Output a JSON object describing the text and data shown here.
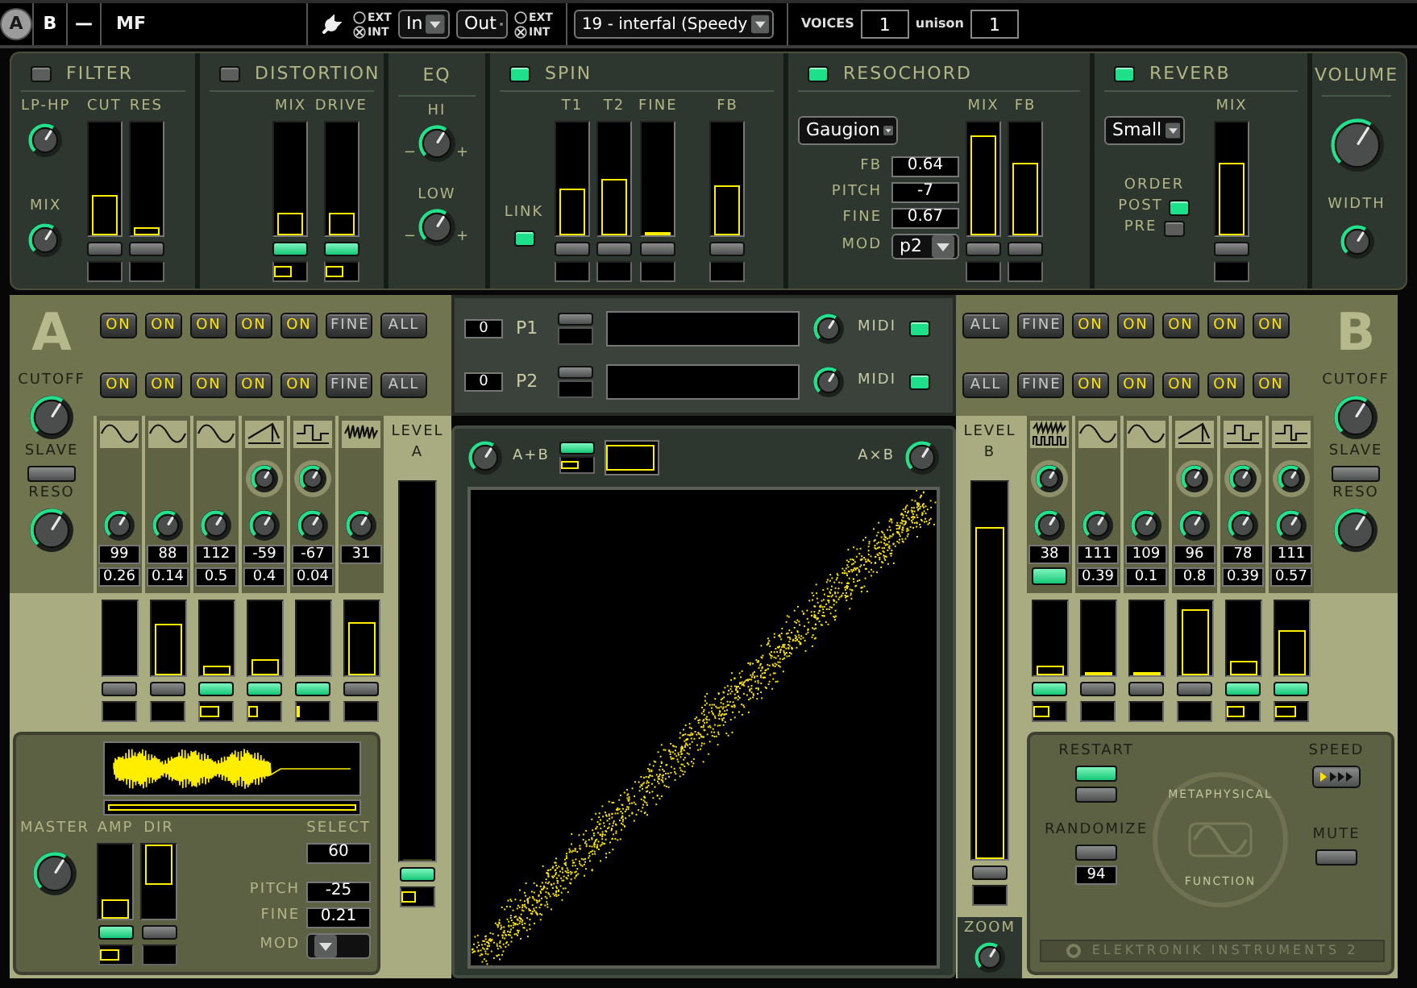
{
  "top_bar": {
    "tabs": [
      {
        "label": "A",
        "selected": true
      },
      {
        "label": "B",
        "selected": false
      },
      {
        "label": "—",
        "selected": false
      }
    ],
    "preset": "MF",
    "in_sync": [
      {
        "label": "EXT",
        "selected": false
      },
      {
        "label": "INT",
        "selected": true
      }
    ],
    "input": "In",
    "output": "Out",
    "out_sync": [
      {
        "label": "EXT",
        "selected": false
      },
      {
        "label": "INT",
        "selected": true
      }
    ],
    "program": "19 - interfal (Speedy",
    "voices_label": "VOICES",
    "voices": "1",
    "unison_label": "unison",
    "unison": "1"
  },
  "effects": [
    {
      "kind": "filter",
      "title": "FILTER",
      "on": false,
      "knobs": [
        {
          "label": "LP-HP"
        },
        {
          "label": "MIX"
        }
      ],
      "faders": [
        {
          "label": "CUT",
          "level": 0.36,
          "on": false
        },
        {
          "label": "RES",
          "level": 0.07,
          "on": false
        }
      ]
    },
    {
      "kind": "distortion",
      "title": "DISTORTION",
      "on": false,
      "faders": [
        {
          "label": "MIX",
          "level": 0.2,
          "on": true,
          "mod": {
            "level": 0.55
          }
        },
        {
          "label": "DRIVE",
          "level": 0.2,
          "on": true,
          "mod": {
            "level": 0.55
          }
        }
      ]
    },
    {
      "kind": "eq",
      "title": "EQ",
      "knobs": [
        {
          "label": "HI",
          "min_label": "−",
          "max_label": "+"
        },
        {
          "label": "LOW",
          "min_label": "−",
          "max_label": "+"
        }
      ]
    },
    {
      "kind": "spin",
      "title": "SPIN",
      "on": true,
      "link_label": "LINK",
      "link_on": true,
      "faders": [
        {
          "label": "T1",
          "level": 0.42,
          "on": false
        },
        {
          "label": "T2",
          "level": 0.5,
          "on": false
        },
        {
          "label": "FINE",
          "level": 0.03,
          "on": false
        },
        {
          "label": "FB",
          "level": 0.45,
          "on": false
        }
      ]
    },
    {
      "kind": "resochord",
      "title": "RESOCHORD",
      "on": true,
      "chord": "Gaugion",
      "fields": [
        {
          "label": "FB",
          "value": "0.64"
        },
        {
          "label": "PITCH",
          "value": "-7"
        },
        {
          "label": "FINE",
          "value": "0.67"
        }
      ],
      "mod": {
        "label": "MOD",
        "value": "p2"
      },
      "faders": [
        {
          "label": "MIX",
          "level": 0.88,
          "on": false
        },
        {
          "label": "FB",
          "level": 0.65,
          "on": false
        }
      ]
    },
    {
      "kind": "reverb",
      "title": "REVERB",
      "on": true,
      "size": "Small",
      "order_label": "ORDER",
      "order": [
        {
          "label": "POST",
          "selected": true
        },
        {
          "label": "PRE",
          "selected": false
        }
      ],
      "faders": [
        {
          "label": "MIX",
          "level": 0.65,
          "on": false
        }
      ]
    },
    {
      "kind": "volume",
      "title": "VOLUME",
      "width": {
        "label": "WIDTH"
      }
    }
  ],
  "osc_a": {
    "letter": "A",
    "cutoff": {
      "label": "CUTOFF"
    },
    "slave": {
      "label": "SLAVE",
      "on": false
    },
    "reso": {
      "label": "RESO"
    },
    "button_rows": [
      [
        {
          "kind": "on",
          "label": "ON"
        },
        {
          "kind": "on",
          "label": "ON"
        },
        {
          "kind": "on",
          "label": "ON"
        },
        {
          "kind": "on",
          "label": "ON"
        },
        {
          "kind": "on",
          "label": "ON"
        },
        {
          "kind": "fine",
          "label": "FINE"
        },
        {
          "kind": "all",
          "label": "ALL"
        }
      ],
      [
        {
          "kind": "on",
          "label": "ON"
        },
        {
          "kind": "on",
          "label": "ON"
        },
        {
          "kind": "on",
          "label": "ON"
        },
        {
          "kind": "on",
          "label": "ON"
        },
        {
          "kind": "on",
          "label": "ON"
        },
        {
          "kind": "fine",
          "label": "FINE"
        },
        {
          "kind": "all",
          "label": "ALL"
        }
      ]
    ],
    "oscillators": [
      {
        "kind": "sine",
        "shape_knob": false,
        "value": "99",
        "fine": "0.26",
        "level": 0,
        "on": false
      },
      {
        "kind": "sine",
        "shape_knob": false,
        "value": "88",
        "fine": "0.14",
        "level": 0.7,
        "on": false
      },
      {
        "kind": "sine",
        "shape_knob": false,
        "value": "112",
        "fine": "0.5",
        "level": 0.12,
        "on": true,
        "mod": {
          "level": 0.6
        }
      },
      {
        "kind": "ramp",
        "shape_knob": true,
        "value": "-59",
        "fine": "0.4",
        "level": 0.22,
        "on": true,
        "mod": {
          "level": 0.3
        }
      },
      {
        "kind": "square",
        "shape_knob": true,
        "value": "-67",
        "fine": "0.04",
        "level": 0,
        "on": true,
        "mod": {
          "level": 0.12
        }
      },
      {
        "kind": "noise",
        "shape_knob": false,
        "value": "31",
        "level": 0.72,
        "on": false
      }
    ],
    "level": {
      "label": "LEVEL",
      "sub": "A",
      "level": 0,
      "on": true,
      "mod": {
        "level": 0.45
      }
    }
  },
  "center": {
    "pitch_rows": [
      {
        "value": "0",
        "label": "P1",
        "midi_label": "MIDI",
        "midi_on": true
      },
      {
        "value": "0",
        "label": "P2",
        "midi_label": "MIDI",
        "midi_on": true
      }
    ],
    "scope": {
      "left_label": "A+B",
      "mode_on": true,
      "mode_mod": {
        "level": 0.55
      },
      "right_label": "A×B"
    }
  },
  "osc_b": {
    "letter": "B",
    "cutoff": {
      "label": "CUTOFF"
    },
    "slave": {
      "label": "SLAVE",
      "on": false
    },
    "reso": {
      "label": "RESO"
    },
    "button_rows": [
      [
        {
          "kind": "all",
          "label": "ALL"
        },
        {
          "kind": "fine",
          "label": "FINE"
        },
        {
          "kind": "on",
          "label": "ON"
        },
        {
          "kind": "on",
          "label": "ON"
        },
        {
          "kind": "on",
          "label": "ON"
        },
        {
          "kind": "on",
          "label": "ON"
        },
        {
          "kind": "on",
          "label": "ON"
        }
      ],
      [
        {
          "kind": "all",
          "label": "ALL"
        },
        {
          "kind": "fine",
          "label": "FINE"
        },
        {
          "kind": "on",
          "label": "ON"
        },
        {
          "kind": "on",
          "label": "ON"
        },
        {
          "kind": "on",
          "label": "ON"
        },
        {
          "kind": "on",
          "label": "ON"
        },
        {
          "kind": "on",
          "label": "ON"
        }
      ]
    ],
    "oscillators": [
      {
        "kind": "noise_pulse",
        "shape_knob": true,
        "value": "38",
        "switch_on": true,
        "level": 0.14,
        "on": true,
        "mod": {
          "level": 0.5
        }
      },
      {
        "kind": "sine",
        "shape_knob": false,
        "value": "111",
        "fine": "0.39",
        "level": 0.03,
        "on": false
      },
      {
        "kind": "sine",
        "shape_knob": false,
        "value": "109",
        "fine": "0.1",
        "level": 0.02,
        "on": false
      },
      {
        "kind": "ramp",
        "shape_knob": true,
        "value": "96",
        "fine": "0.8",
        "level": 0.9,
        "on": false
      },
      {
        "kind": "square",
        "shape_knob": true,
        "value": "78",
        "fine": "0.39",
        "level": 0.2,
        "on": true,
        "mod": {
          "level": 0.55
        }
      },
      {
        "kind": "pulse",
        "shape_knob": true,
        "value": "111",
        "fine": "0.57",
        "level": 0.6,
        "on": true,
        "mod": {
          "level": 0.65
        }
      }
    ],
    "level": {
      "label": "LEVEL",
      "sub": "B",
      "level": 0.88,
      "on": false
    },
    "zoom": {
      "label": "ZOOM"
    }
  },
  "sampler": {
    "master": {
      "label": "MASTER"
    },
    "amp": {
      "label": "AMP",
      "level": 0.25,
      "on": true,
      "mod": {
        "level": 0.6
      }
    },
    "dir": {
      "label": "DIR",
      "level": 0.55,
      "on": false,
      "from_top": true
    },
    "select": {
      "label": "SELECT",
      "value": "60"
    },
    "fields": [
      {
        "label": "PITCH",
        "value": "-25"
      },
      {
        "label": "FINE",
        "value": "0.21"
      }
    ],
    "mod": {
      "label": "MOD"
    }
  },
  "randomizer": {
    "restart": {
      "label": "RESTART",
      "on": true
    },
    "randomize": {
      "label": "RANDOMIZE",
      "value": "94"
    },
    "speed": {
      "label": "SPEED"
    },
    "mute": {
      "label": "MUTE",
      "on": false
    },
    "logo": {
      "top": "METAPHYSICAL",
      "bottom": "FUNCTION"
    },
    "brand": "ELEKTRONIK INSTRUMENTS 2"
  }
}
